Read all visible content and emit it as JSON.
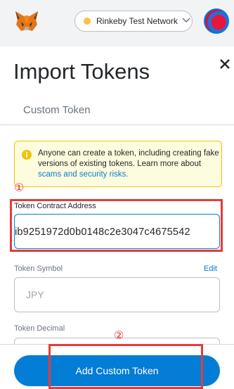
{
  "header": {
    "network_label": "Rinkeby Test Network",
    "network_dot_color": "#f6c343"
  },
  "page": {
    "title": "Import Tokens",
    "tab_label": "Custom Token"
  },
  "warning": {
    "text": "Anyone can create a token, including creating fake versions of existing tokens. Learn more about ",
    "link_text": "scams and security risks.",
    "icon": "info-icon"
  },
  "annotations": {
    "marker_1": "①",
    "marker_2": "②"
  },
  "fields": {
    "address_label": "Token Contract Address",
    "address_value": "ib9251972d0b0148c2e3047c4675542",
    "symbol_label": "Token Symbol",
    "symbol_value": "JPY",
    "edit_label": "Edit",
    "decimal_label": "Token Decimal"
  },
  "footer": {
    "button_label": "Add Custom Token"
  },
  "colors": {
    "accent": "#037dd6",
    "annotation_red": "#e83a3a",
    "warning_bg": "#fefcde"
  }
}
